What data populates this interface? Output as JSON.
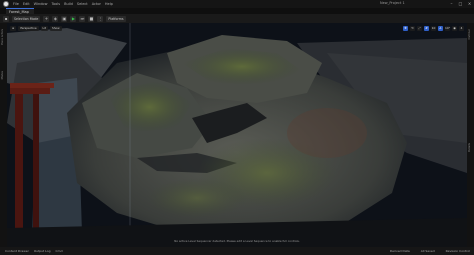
{
  "app": {
    "project_name": "New_Project 1",
    "menus": [
      "File",
      "Edit",
      "Window",
      "Tools",
      "Build",
      "Select",
      "Actor",
      "Help"
    ]
  },
  "tab": {
    "level_name": "Forest_Map"
  },
  "toolbar": {
    "mode_label": "Selection Mode",
    "platforms_label": "Platforms"
  },
  "viewport": {
    "chips": [
      "Perspective",
      "Lit",
      "Show"
    ],
    "right_tools": [
      "move",
      "rotate",
      "scale",
      "grid",
      "10",
      "snap",
      "10°",
      "camera",
      "4"
    ],
    "message": "No active Level Sequencer detected. Please edit a Level Sequence to enable full controls."
  },
  "left_dock": [
    "Place Actors",
    "Modes"
  ],
  "right_dock": [
    "Outliner",
    "Details"
  ],
  "statusbar": {
    "items": [
      "Content Drawer",
      "Output Log",
      "Cmd"
    ],
    "right_items": [
      "Derived Data",
      "All Saved",
      "Revision Control"
    ]
  },
  "colors": {
    "accent": "#3c6fd8",
    "play": "#37c24d"
  }
}
